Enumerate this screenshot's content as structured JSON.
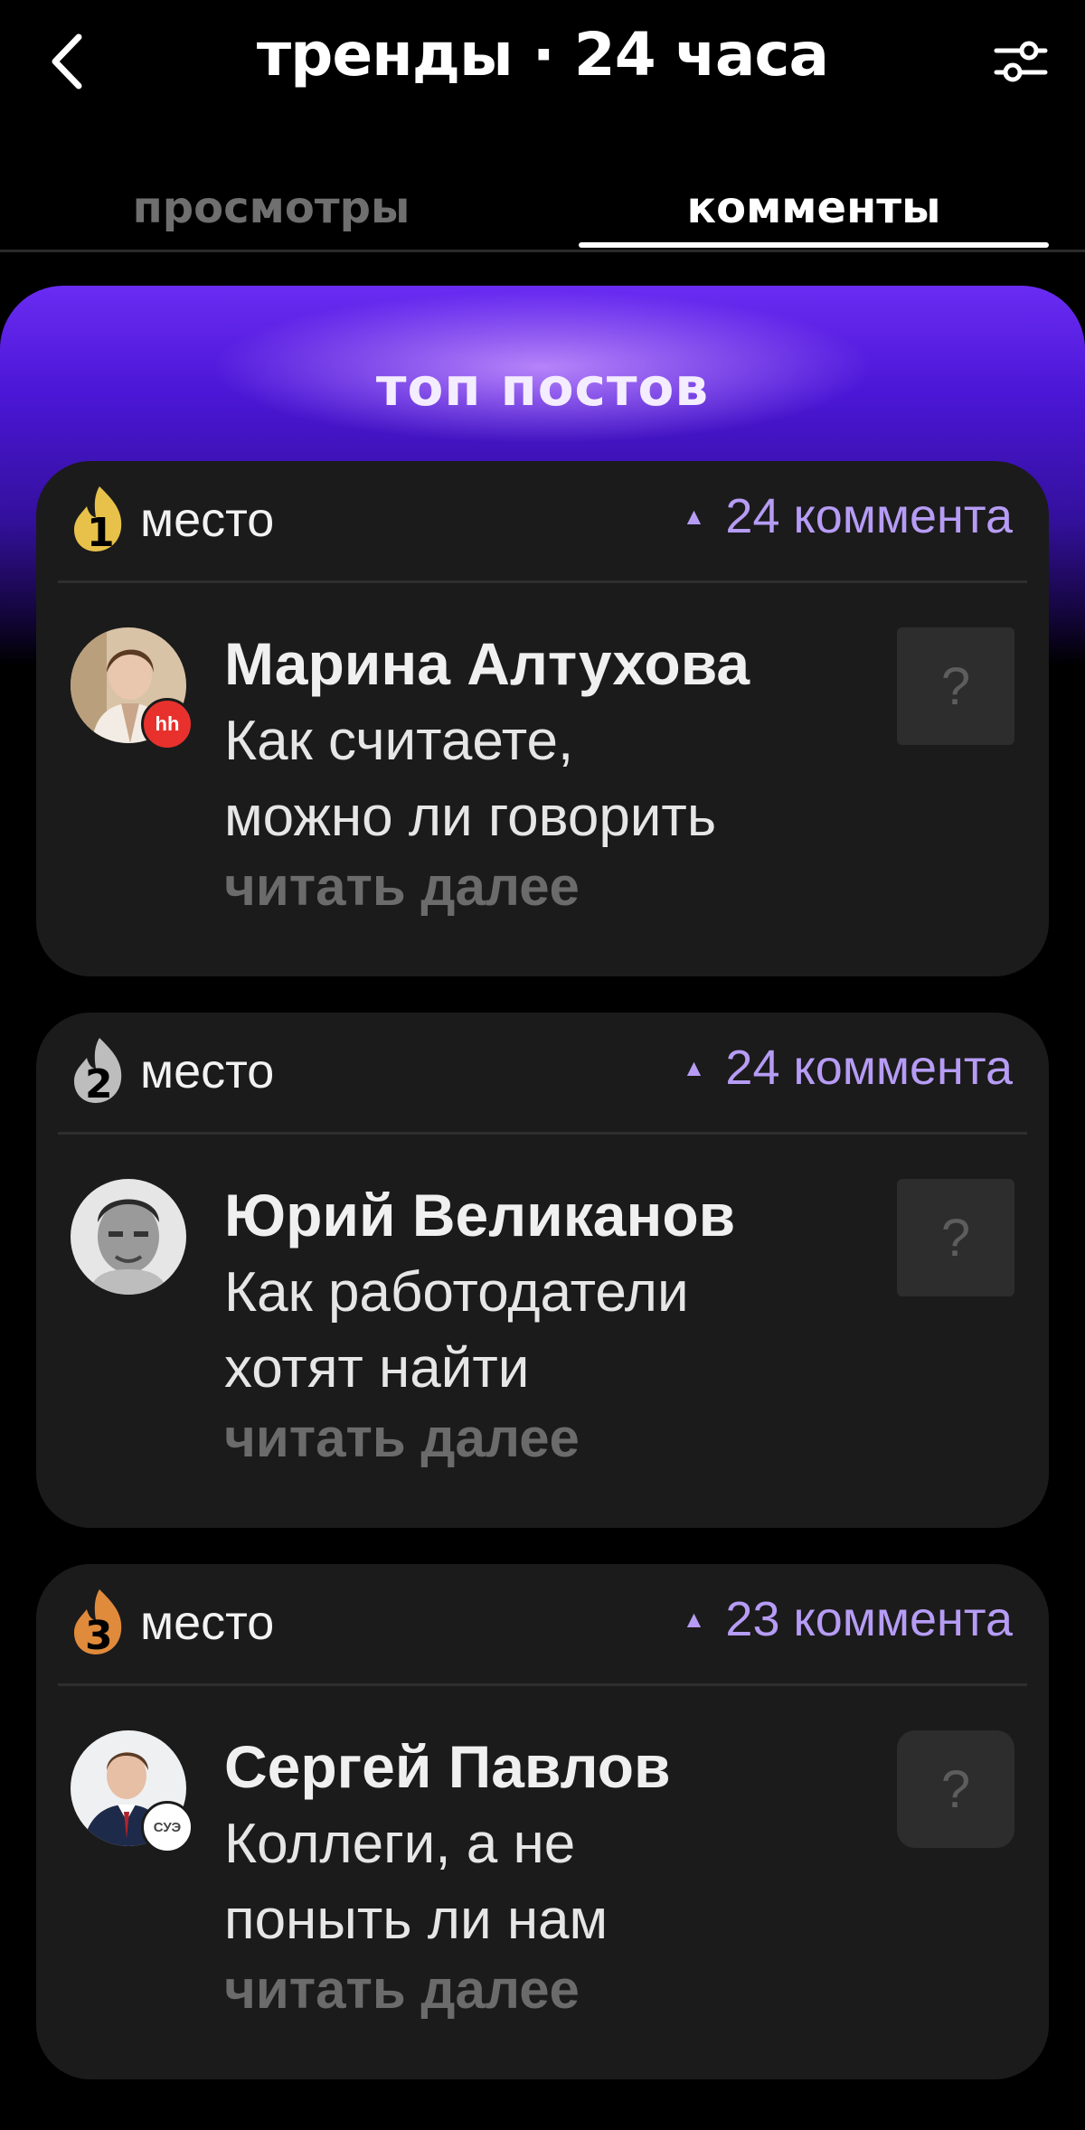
{
  "header": {
    "title": "тренды · 24 часа",
    "back_icon": "chevron-left-icon",
    "filter_icon": "sliders-icon"
  },
  "tabs": [
    {
      "label": "просмотры",
      "active": false
    },
    {
      "label": "комменты",
      "active": true
    }
  ],
  "panel": {
    "title": "топ постов",
    "accent": "#6a2cf2"
  },
  "posts": [
    {
      "place": "1",
      "place_label": "место",
      "count": "24 коммента",
      "author": "Марина Алтухова",
      "text_line1": "Как считаете,",
      "text_line2": "можно ли говорить",
      "read_more": "читать далее",
      "badge": "hh",
      "thumb": "?",
      "medal_color": "#e7c14a"
    },
    {
      "place": "2",
      "place_label": "место",
      "count": "24 коммента",
      "author": "Юрий Великанов",
      "text_line1": "Как работодатели",
      "text_line2": "хотят найти",
      "read_more": "читать далее",
      "badge": "",
      "thumb": "?",
      "medal_color": "#bdbdbd"
    },
    {
      "place": "3",
      "place_label": "место",
      "count": "23 коммента",
      "author": "Сергей Павлов",
      "text_line1": "Коллеги, а не",
      "text_line2": "поныть ли нам",
      "read_more": "читать далее",
      "badge": "СУЭ",
      "thumb": "?",
      "medal_color": "#e08a3c"
    }
  ]
}
